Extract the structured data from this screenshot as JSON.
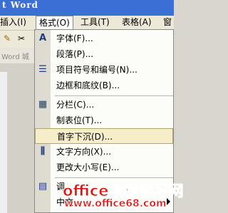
{
  "window": {
    "title": "t Word"
  },
  "menubar": {
    "items": [
      "插入(I)",
      "格式(O)",
      "工具(T)",
      "表格(A)",
      "窗"
    ]
  },
  "ruler": {
    "text": "Word 城"
  },
  "format_menu": {
    "items": [
      {
        "label": "字体(F)...",
        "icon": "font-A-icon"
      },
      {
        "label": "段落(P)...",
        "icon": ""
      },
      {
        "label": "项目符号和编号(N)...",
        "icon": "bullets-icon"
      },
      {
        "label": "边框和底纹(B)...",
        "icon": ""
      },
      {
        "label": "分栏(C)...",
        "icon": "columns-icon"
      },
      {
        "label": "制表位(T)...",
        "icon": ""
      },
      {
        "label": "首字下沉(D)...",
        "icon": ""
      },
      {
        "label": "文字方向(X)...",
        "icon": "text-direction-icon"
      },
      {
        "label": "更改大小写(E)...",
        "icon": ""
      },
      {
        "label": "调",
        "icon": ""
      },
      {
        "label": "中文",
        "icon": ""
      }
    ],
    "highlighted": "首字下沉(D)..."
  },
  "watermark": {
    "line1": "office教程学习网",
    "line2": "www.office68.com"
  },
  "colors": {
    "titlebar": "#3b6fd6",
    "menu_bg": "#fcfcf9",
    "highlight": "#f5eec8",
    "watermark": "#e01010"
  }
}
